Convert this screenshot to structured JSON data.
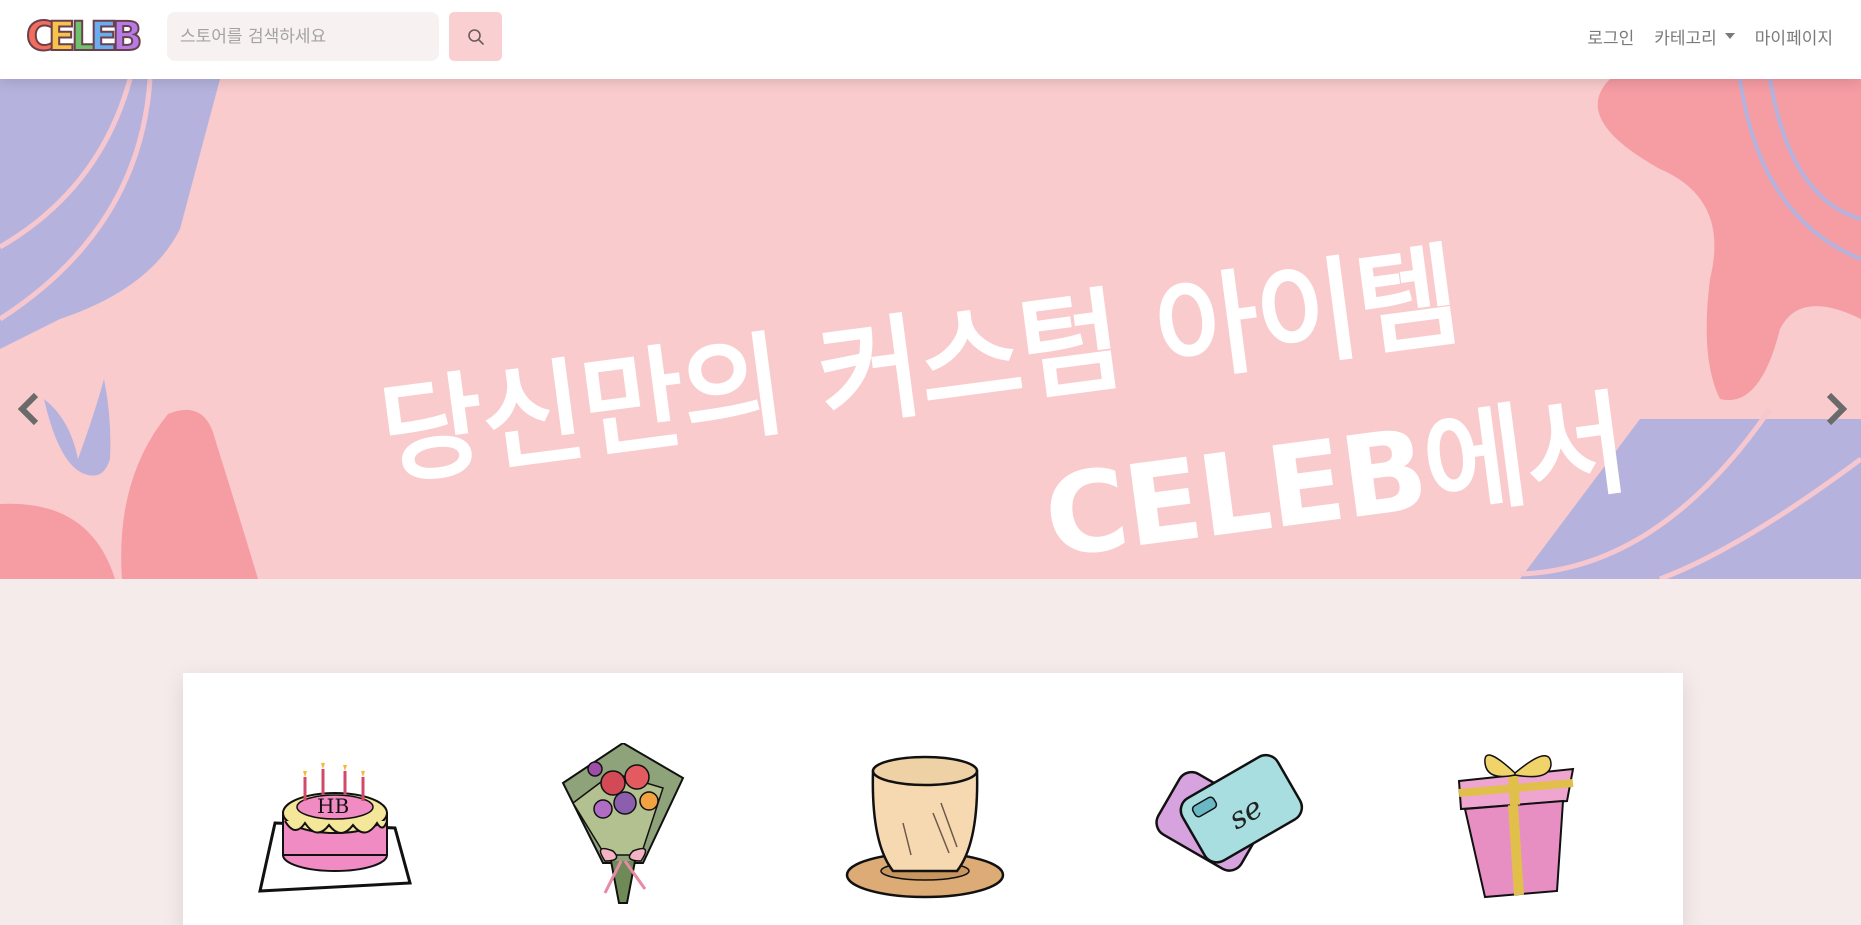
{
  "navbar": {
    "logo": {
      "letters": [
        "C",
        "E",
        "L",
        "E",
        "B"
      ],
      "colors": [
        "#f16e5c",
        "#f7c34b",
        "#6ec26b",
        "#6aaef0",
        "#b57ce6"
      ]
    },
    "search": {
      "placeholder": "스토어를 검색하세요",
      "value": ""
    },
    "links": {
      "login": "로그인",
      "category": "카테고리",
      "mypage": "마이페이지"
    }
  },
  "banner": {
    "line1": "당신만의 커스텀 아이템",
    "line2": "CELEB에서",
    "colors": {
      "background": "#f9cbcd",
      "lavender": "#b5b3dd",
      "coral": "#f69ca3"
    }
  },
  "categories": {
    "items": [
      {
        "icon": "cake-icon"
      },
      {
        "icon": "bouquet-icon"
      },
      {
        "icon": "cup-icon"
      },
      {
        "icon": "phone-case-icon"
      },
      {
        "icon": "gift-box-icon"
      }
    ]
  }
}
